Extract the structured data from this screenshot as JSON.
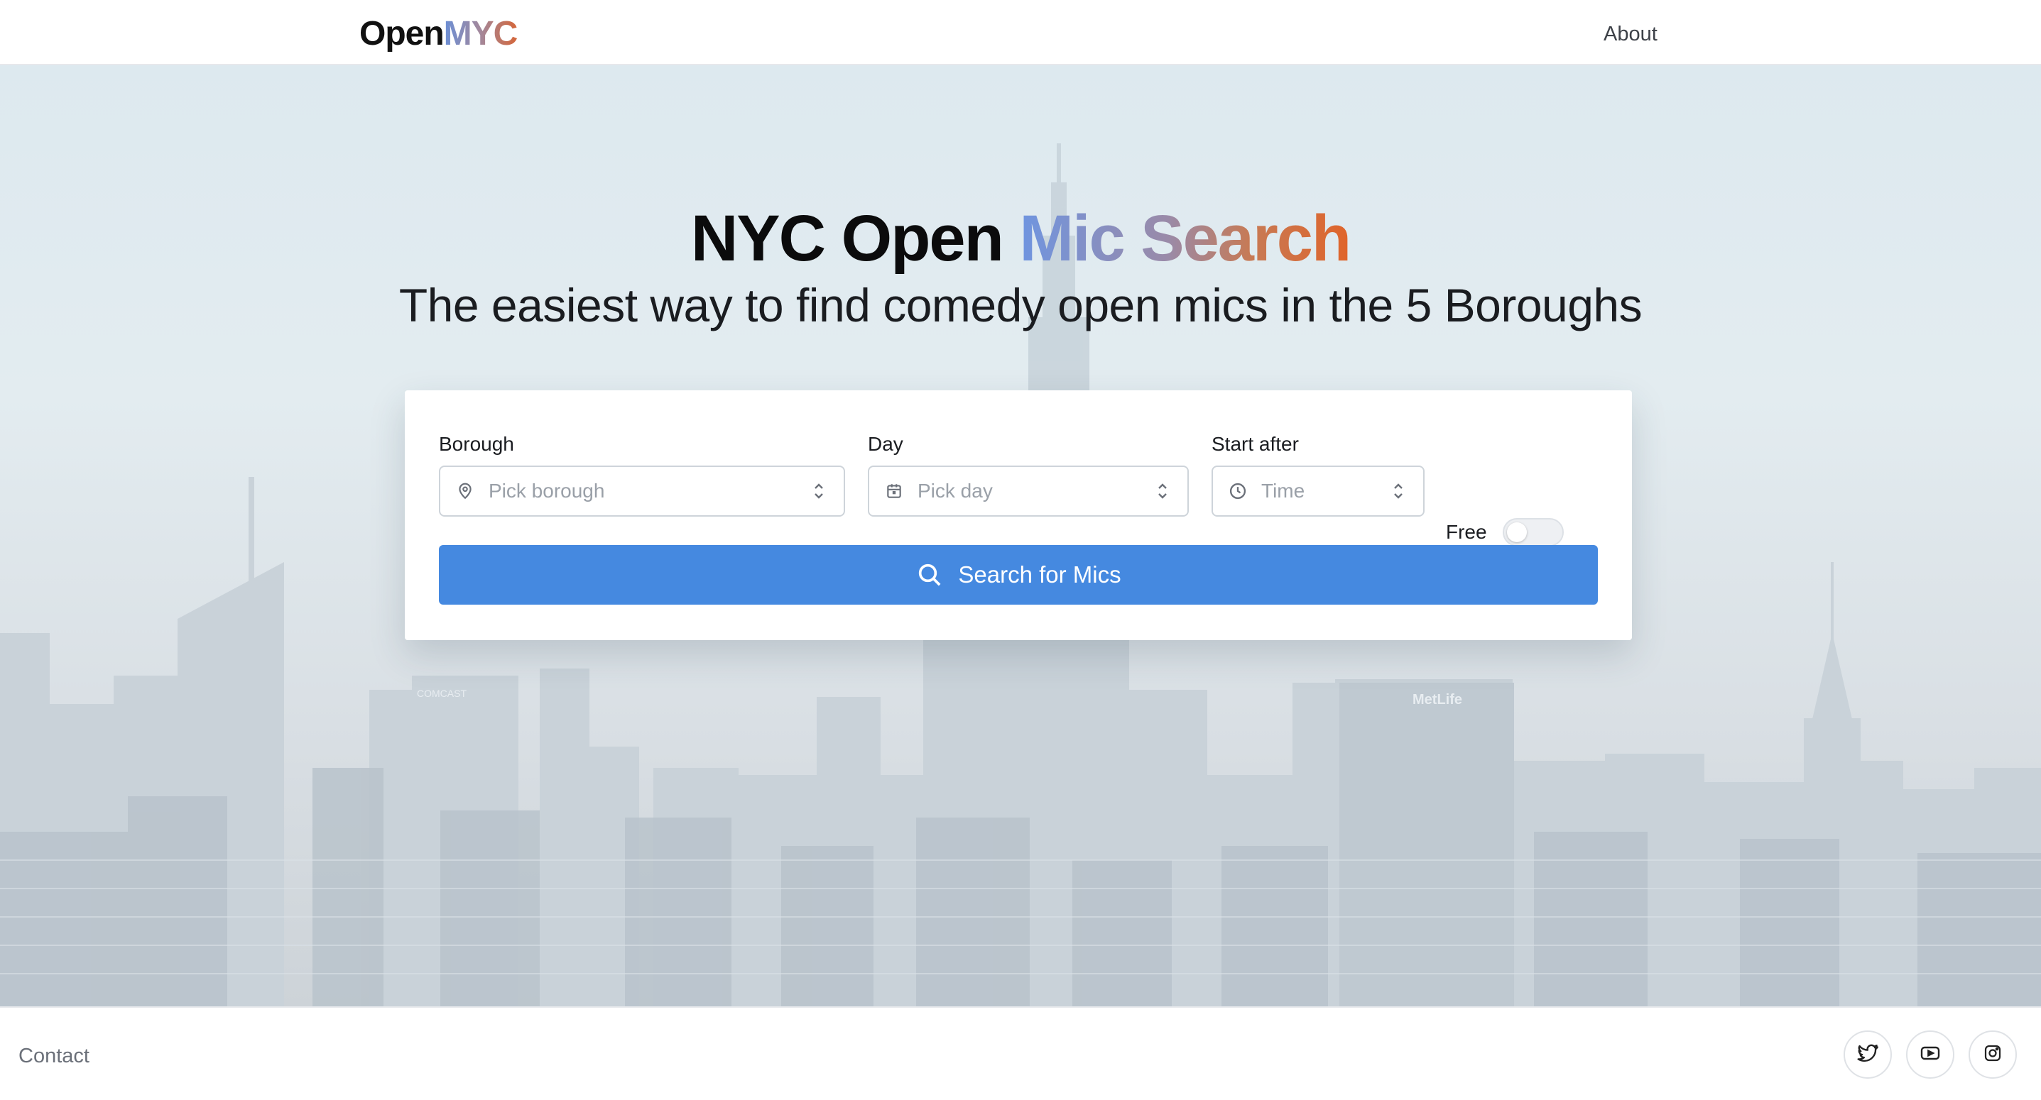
{
  "header": {
    "logo_prefix": "Open",
    "logo_accent": "MYC",
    "nav_about": "About"
  },
  "hero": {
    "title_plain": "NYC Open",
    "title_accent": "Mic Search",
    "subtitle": "The easiest way to find comedy open mics in the 5 Boroughs",
    "background_skyline_text": [
      "COMCAST",
      "MetLife"
    ]
  },
  "search": {
    "borough": {
      "label": "Borough",
      "placeholder": "Pick borough",
      "icon": "map-pin-icon"
    },
    "day": {
      "label": "Day",
      "placeholder": "Pick day",
      "icon": "calendar-icon"
    },
    "start_after": {
      "label": "Start after",
      "placeholder": "Time",
      "icon": "clock-icon"
    },
    "free": {
      "label": "Free",
      "checked": false
    },
    "button_label": "Search for Mics",
    "button_icon": "search-icon"
  },
  "footer": {
    "contact": "Contact",
    "socials": [
      "twitter-icon",
      "youtube-icon",
      "instagram-icon"
    ]
  },
  "colors": {
    "primary_button": "#4589e0",
    "accent_gradient_start": "#6f95e0",
    "accent_gradient_end": "#e0642a"
  }
}
